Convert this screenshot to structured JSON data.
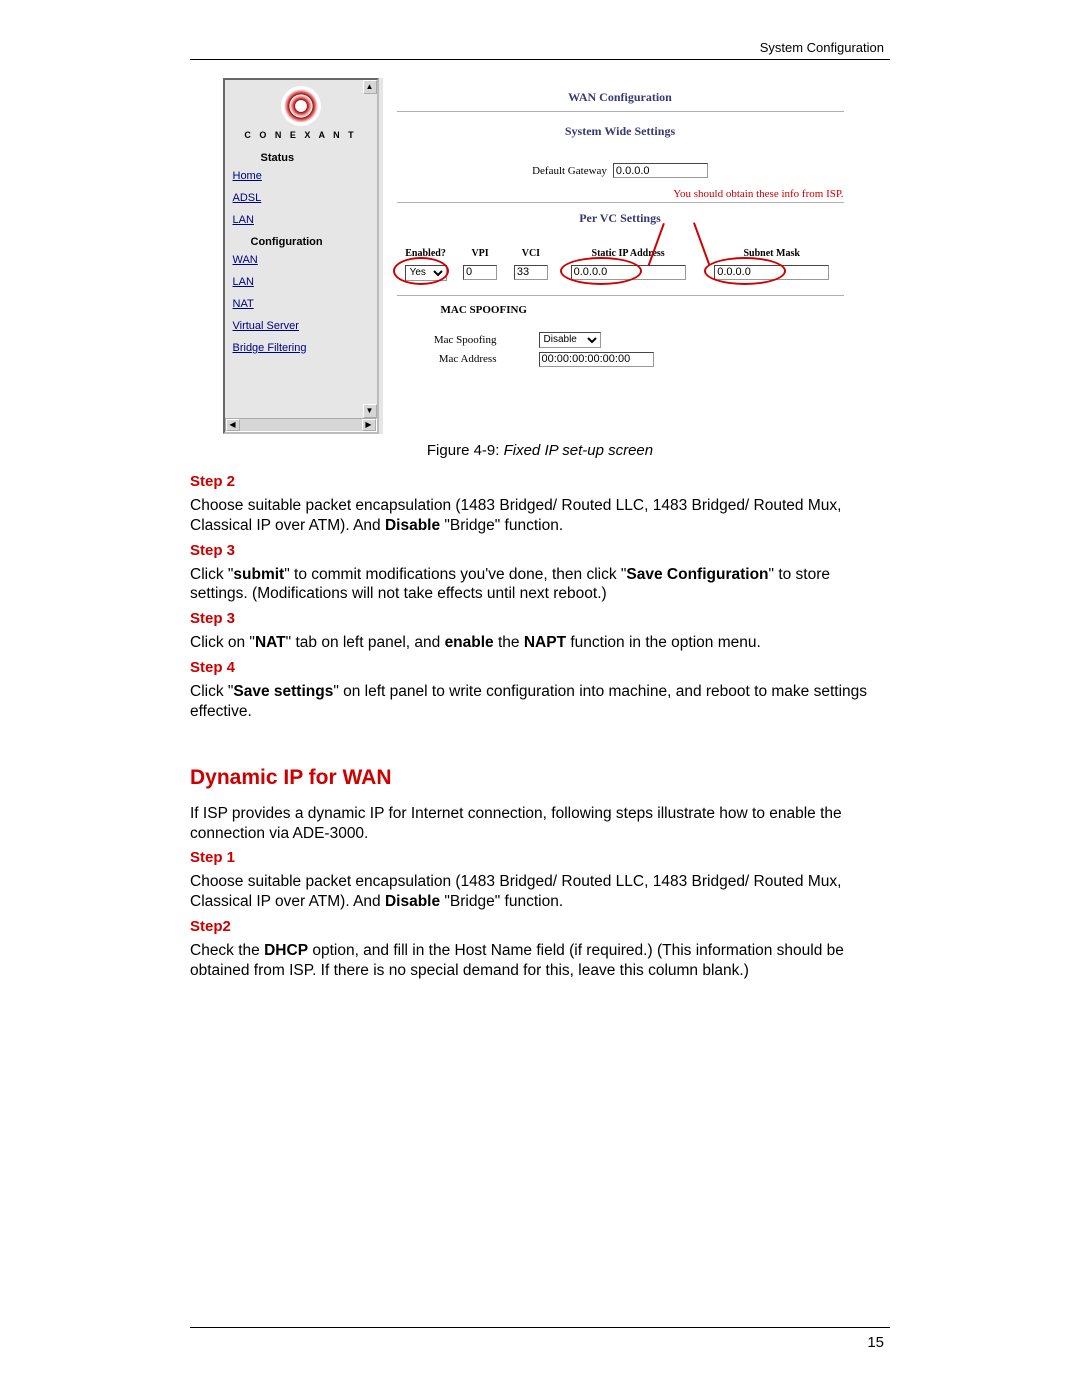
{
  "header": "System Configuration",
  "pagenum": "15",
  "screenshot": {
    "brand": "C O N E X A N T",
    "sidebar": {
      "section1": "Status",
      "links1": [
        "Home",
        "ADSL",
        "LAN"
      ],
      "section2": "Configuration",
      "links2": [
        "WAN",
        "LAN",
        "NAT",
        "Virtual Server",
        "Bridge Filtering"
      ]
    },
    "title": "WAN Configuration",
    "subtitle1": "System Wide Settings",
    "default_gateway_label": "Default Gateway",
    "default_gateway_value": "0.0.0.0",
    "note": "You should obtain these info from ISP.",
    "subtitle2": "Per VC Settings",
    "headers": {
      "enabled": "Enabled?",
      "vpi": "VPI",
      "vci": "VCI",
      "sip": "Static IP Address",
      "mask": "Subnet Mask"
    },
    "row": {
      "enabled": "Yes",
      "vpi": "0",
      "vci": "33",
      "sip": "0.0.0.0",
      "mask": "0.0.0.0"
    },
    "mac_heading": "MAC SPOOFING",
    "mac_spoof_label": "Mac Spoofing",
    "mac_spoof_value": "Disable",
    "mac_addr_label": "Mac Address",
    "mac_addr_value": "00:00:00:00:00:00"
  },
  "caption_prefix": "Figure 4-9: ",
  "caption_italic": "Fixed IP set-up screen",
  "body": {
    "step2": "Step 2",
    "p1a": "Choose suitable packet encapsulation (1483 Bridged/ Routed LLC, 1483 Bridged/ Routed Mux, Classical IP over ATM). And ",
    "p1b": "Disable",
    "p1c": " \"Bridge\" function.",
    "step3a": "Step 3",
    "p2a": "Click \"",
    "p2b": "submit",
    "p2c": "\" to commit modifications you've done, then click \"",
    "p2d": "Save Configuration",
    "p2e": "\" to store settings. (Modifications will not take effects until next reboot.)",
    "step3b": "Step 3",
    "p3a": "Click on \"",
    "p3b": "NAT",
    "p3c": "\" tab on left panel, and ",
    "p3d": "enable",
    "p3e": " the ",
    "p3f": "NAPT",
    "p3g": " function in the option menu.",
    "step4": "Step 4",
    "p4a": "Click \"",
    "p4b": "Save settings",
    "p4c": "\" on left panel to write configuration into machine, and reboot to make settings effective.",
    "h2": "Dynamic IP for WAN",
    "p5": "If ISP provides a dynamic IP for Internet connection, following steps illustrate how to enable the connection via ADE-3000.",
    "step1": "Step 1",
    "p6a": "Choose suitable packet encapsulation (1483 Bridged/ Routed LLC, 1483 Bridged/ Routed Mux, Classical IP over ATM). And ",
    "p6b": "Disable",
    "p6c": " \"Bridge\" function.",
    "step2b": "Step2",
    "p7a": "Check the ",
    "p7b": "DHCP",
    "p7c": " option, and fill in the Host Name field (if required.) (This information should be obtained from ISP. If there is no special demand for this, leave this column blank.)"
  }
}
